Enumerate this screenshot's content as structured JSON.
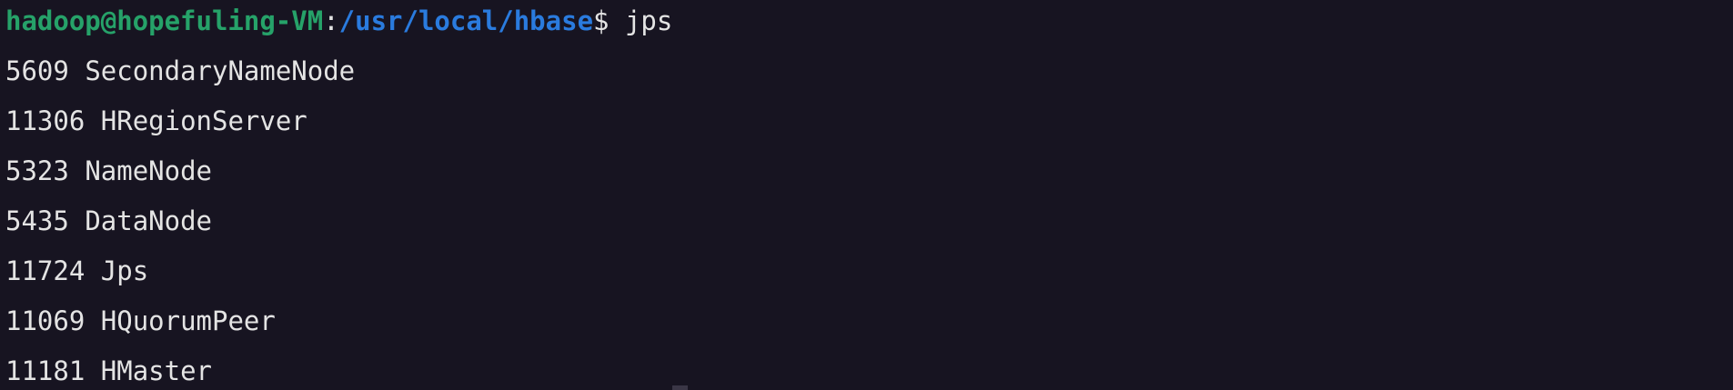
{
  "terminal": {
    "prompt": {
      "user_host": "hadoop@hopefuling-VM",
      "separator": ":",
      "path": "/usr/local/hbase",
      "symbol": "$",
      "command": " jps"
    },
    "output": [
      {
        "pid": "5609",
        "name": "SecondaryNameNode"
      },
      {
        "pid": "11306",
        "name": "HRegionServer"
      },
      {
        "pid": "5323",
        "name": "NameNode"
      },
      {
        "pid": "5435",
        "name": "DataNode"
      },
      {
        "pid": "11724",
        "name": "Jps"
      },
      {
        "pid": "11069",
        "name": "HQuorumPeer"
      },
      {
        "pid": "11181",
        "name": "HMaster"
      }
    ],
    "colors": {
      "background": "#171421",
      "text": "#e4e4e4",
      "user_host": "#26a269",
      "path": "#2a7bde"
    }
  }
}
